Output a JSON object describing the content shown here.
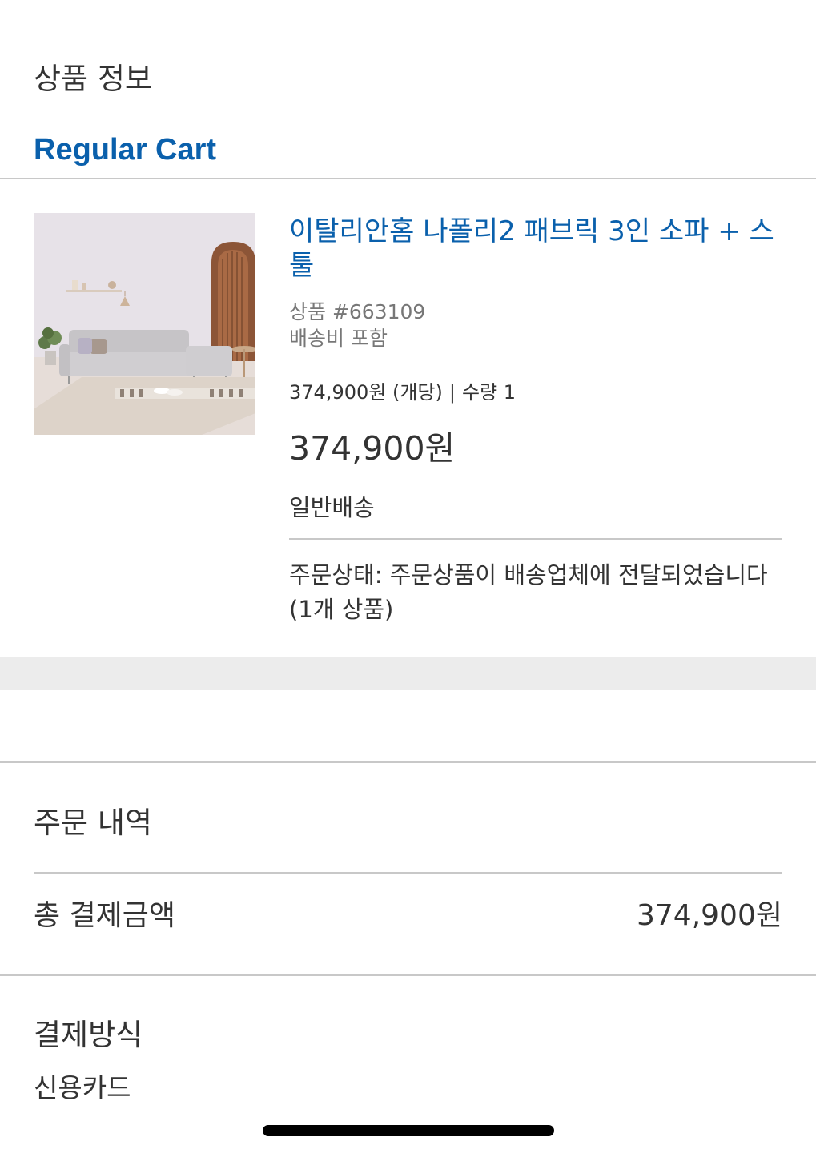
{
  "product_section": {
    "title": "상품 정보"
  },
  "cart": {
    "title": "Regular Cart"
  },
  "item": {
    "image_alt": "sofa-room-photo",
    "name": "이탈리안홈 나폴리2 패브릭 3인 소파 + 스툴",
    "item_number": "상품 #663109",
    "shipping_fee_note": "배송비 포함",
    "unit_price": "374,900원 (개당)",
    "separator": "|",
    "quantity": "수량 1",
    "total_price": "374,900원",
    "shipping_type": "일반배송",
    "status": "주문상태: 주문상품이 배송업체에 전달되었습니다 (1개 상품)"
  },
  "order_summary": {
    "title": "주문 내역",
    "total_label": "총 결제금액",
    "total_value": "374,900원"
  },
  "payment": {
    "title": "결제방식",
    "method": "신용카드"
  },
  "colors": {
    "accent": "#0a60ac",
    "text": "#333333",
    "muted": "#777777",
    "divider": "#c8c8c8",
    "band": "#ececec"
  }
}
